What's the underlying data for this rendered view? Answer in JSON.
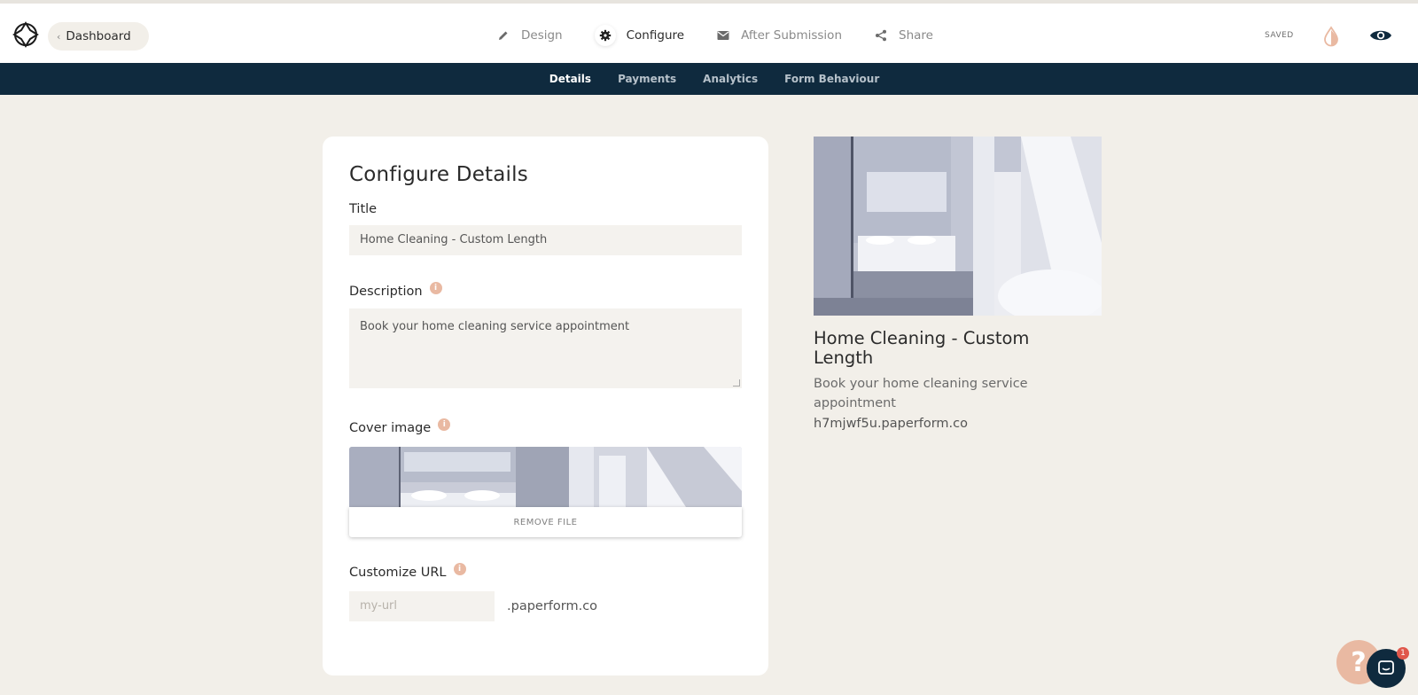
{
  "header": {
    "back_label": "Dashboard",
    "steps": [
      {
        "label": "Design",
        "icon": "pencil-icon",
        "active": false
      },
      {
        "label": "Configure",
        "icon": "gear-icon",
        "active": true
      },
      {
        "label": "After Submission",
        "icon": "envelope-icon",
        "active": false
      },
      {
        "label": "Share",
        "icon": "share-icon",
        "active": false
      }
    ],
    "saved_status": "SAVED"
  },
  "subnav": {
    "tabs": [
      {
        "label": "Details",
        "active": true
      },
      {
        "label": "Payments",
        "active": false
      },
      {
        "label": "Analytics",
        "active": false
      },
      {
        "label": "Form Behaviour",
        "active": false
      }
    ]
  },
  "form": {
    "heading": "Configure Details",
    "title_label": "Title",
    "title_value": "Home Cleaning - Custom Length",
    "description_label": "Description",
    "description_value": "Book your home cleaning service appointment",
    "cover_label": "Cover image",
    "remove_file_label": "REMOVE FILE",
    "url_label": "Customize URL",
    "url_placeholder": "my-url",
    "url_suffix": ".paperform.co"
  },
  "preview": {
    "title": "Home Cleaning - Custom Length",
    "description": "Book your home cleaning service appointment",
    "url": "h7mjwf5u.paperform.co"
  },
  "widgets": {
    "help_glyph": "?",
    "chat_badge_count": "1"
  },
  "colors": {
    "navy": "#0f2a3e",
    "accent": "#e9b9a2",
    "background": "#f2efe9"
  }
}
